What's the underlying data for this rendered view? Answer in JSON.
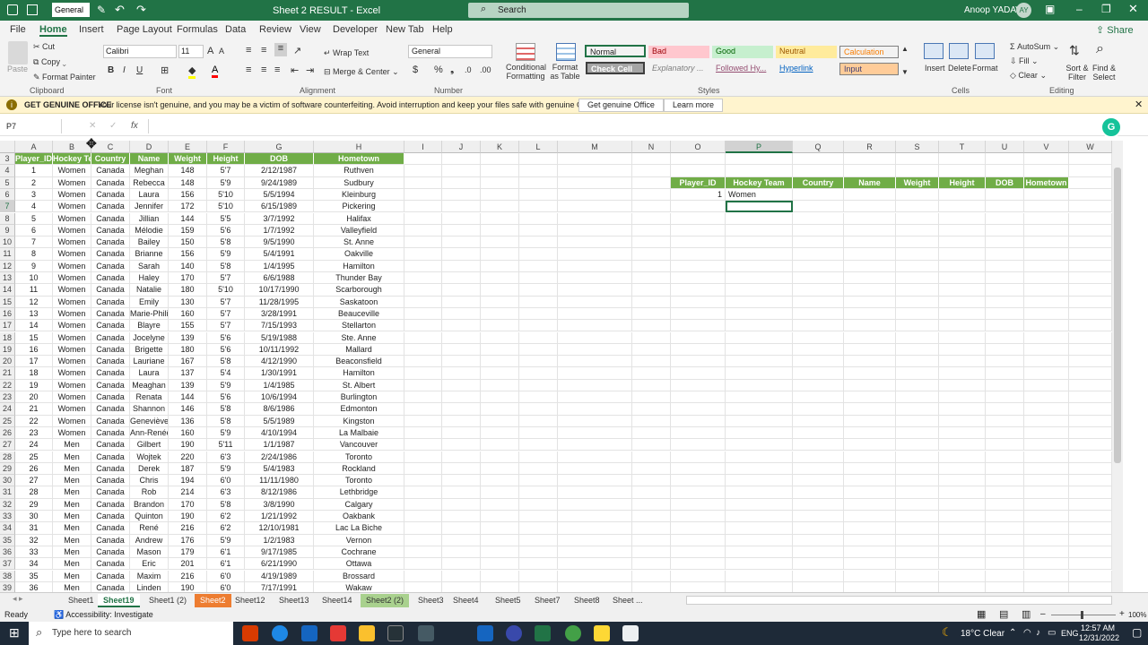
{
  "title_bar": {
    "number_format": "General",
    "title": "Sheet 2 RESULT  -  Excel",
    "search": "Search",
    "user": "Anoop YADAV",
    "initials": "AY"
  },
  "menu": [
    "File",
    "Home",
    "Insert",
    "Page Layout",
    "Formulas",
    "Data",
    "Review",
    "View",
    "Developer",
    "New Tab",
    "Help"
  ],
  "share": "Share",
  "ribbon": {
    "paste": "Paste",
    "cut": "Cut",
    "copy": "Copy",
    "format_painter": "Format Painter",
    "clipboard": "Clipboard",
    "font_name": "Calibri",
    "font_size": "11",
    "font": "Font",
    "wrap_text": "Wrap Text",
    "merge_center": "Merge & Center",
    "alignment": "Alignment",
    "number_format": "General",
    "number": "Number",
    "conditional": "Conditional Formatting",
    "format_as_table": "Format as Table",
    "styles": "Styles",
    "style_cells": [
      {
        "label": "Normal",
        "bg": "#ffffff",
        "color": "#000000"
      },
      {
        "label": "Bad",
        "bg": "#ffc7ce",
        "color": "#9c0006"
      },
      {
        "label": "Good",
        "bg": "#c6efce",
        "color": "#006100"
      },
      {
        "label": "Neutral",
        "bg": "#ffeb9c",
        "color": "#9c5700"
      },
      {
        "label": "Calculation",
        "bg": "#f2f2f2",
        "color": "#fa7d00"
      },
      {
        "label": "Check Cell",
        "bg": "#a5a5a5",
        "color": "#ffffff"
      },
      {
        "label": "Explanatory ...",
        "bg": "#ffffff",
        "color": "#7f7f7f"
      },
      {
        "label": "Followed Hy...",
        "bg": "#ffffff",
        "color": "#954f72"
      },
      {
        "label": "Hyperlink",
        "bg": "#ffffff",
        "color": "#0563c1"
      },
      {
        "label": "Input",
        "bg": "#ffcc99",
        "color": "#3f3f76"
      }
    ],
    "insert": "Insert",
    "delete": "Delete",
    "format": "Format",
    "cells": "Cells",
    "autosum": "AutoSum",
    "fill": "Fill",
    "clear": "Clear",
    "sort_filter": "Sort & Filter",
    "find_select": "Find & Select",
    "editing": "Editing"
  },
  "message": {
    "title": "GET GENUINE OFFICE",
    "text": "Your license isn't genuine, and you may be a victim of software counterfeiting. Avoid interruption and keep your files safe with genuine Office today.",
    "btn1": "Get genuine Office",
    "btn2": "Learn more"
  },
  "namebox": "P7",
  "fx": "fx",
  "columns": [
    "A",
    "B",
    "C",
    "D",
    "E",
    "F",
    "G",
    "H",
    "I",
    "J",
    "K",
    "L",
    "M",
    "N",
    "O",
    "P",
    "Q",
    "R",
    "S",
    "T",
    "U",
    "V",
    "W"
  ],
  "table_headers": [
    "Player_ID",
    "Hockey Team",
    "Country",
    "Name",
    "Weight",
    "Height",
    "DOB",
    "Hometown"
  ],
  "rows": [
    [
      "1",
      "Women",
      "Canada",
      "Meghan",
      "148",
      "5'7",
      "2/12/1987",
      "Ruthven"
    ],
    [
      "2",
      "Women",
      "Canada",
      "Rebecca",
      "148",
      "5'9",
      "9/24/1989",
      "Sudbury"
    ],
    [
      "3",
      "Women",
      "Canada",
      "Laura",
      "156",
      "5'10",
      "5/5/1994",
      "Kleinburg"
    ],
    [
      "4",
      "Women",
      "Canada",
      "Jennifer",
      "172",
      "5'10",
      "6/15/1989",
      "Pickering"
    ],
    [
      "5",
      "Women",
      "Canada",
      "Jillian",
      "144",
      "5'5",
      "3/7/1992",
      "Halifax"
    ],
    [
      "6",
      "Women",
      "Canada",
      "Mélodie",
      "159",
      "5'6",
      "1/7/1992",
      "Valleyfield"
    ],
    [
      "7",
      "Women",
      "Canada",
      "Bailey",
      "150",
      "5'8",
      "9/5/1990",
      "St. Anne"
    ],
    [
      "8",
      "Women",
      "Canada",
      "Brianne",
      "156",
      "5'9",
      "5/4/1991",
      "Oakville"
    ],
    [
      "9",
      "Women",
      "Canada",
      "Sarah",
      "140",
      "5'8",
      "1/4/1995",
      "Hamilton"
    ],
    [
      "10",
      "Women",
      "Canada",
      "Haley",
      "170",
      "5'7",
      "6/6/1988",
      "Thunder Bay"
    ],
    [
      "11",
      "Women",
      "Canada",
      "Natalie",
      "180",
      "5'10",
      "10/17/1990",
      "Scarborough"
    ],
    [
      "12",
      "Women",
      "Canada",
      "Emily",
      "130",
      "5'7",
      "11/28/1995",
      "Saskatoon"
    ],
    [
      "13",
      "Women",
      "Canada",
      "Marie-Philip",
      "160",
      "5'7",
      "3/28/1991",
      "Beauceville"
    ],
    [
      "14",
      "Women",
      "Canada",
      "Blayre",
      "155",
      "5'7",
      "7/15/1993",
      "Stellarton"
    ],
    [
      "15",
      "Women",
      "Canada",
      "Jocelyne",
      "139",
      "5'6",
      "5/19/1988",
      "Ste. Anne"
    ],
    [
      "16",
      "Women",
      "Canada",
      "Brigette",
      "180",
      "5'6",
      "10/11/1992",
      "Mallard"
    ],
    [
      "17",
      "Women",
      "Canada",
      "Lauriane",
      "167",
      "5'8",
      "4/12/1990",
      "Beaconsfield"
    ],
    [
      "18",
      "Women",
      "Canada",
      "Laura",
      "137",
      "5'4",
      "1/30/1991",
      "Hamilton"
    ],
    [
      "19",
      "Women",
      "Canada",
      "Meaghan",
      "139",
      "5'9",
      "1/4/1985",
      "St. Albert"
    ],
    [
      "20",
      "Women",
      "Canada",
      "Renata",
      "144",
      "5'6",
      "10/6/1994",
      "Burlington"
    ],
    [
      "21",
      "Women",
      "Canada",
      "Shannon",
      "146",
      "5'8",
      "8/6/1986",
      "Edmonton"
    ],
    [
      "22",
      "Women",
      "Canada",
      "Geneviève",
      "136",
      "5'8",
      "5/5/1989",
      "Kingston"
    ],
    [
      "23",
      "Women",
      "Canada",
      "Ann-Renée",
      "160",
      "5'9",
      "4/10/1994",
      "La Malbaie"
    ],
    [
      "24",
      "Men",
      "Canada",
      "Gilbert",
      "190",
      "5'11",
      "1/1/1987",
      "Vancouver"
    ],
    [
      "25",
      "Men",
      "Canada",
      "Wojtek",
      "220",
      "6'3",
      "2/24/1986",
      "Toronto"
    ],
    [
      "26",
      "Men",
      "Canada",
      "Derek",
      "187",
      "5'9",
      "5/4/1983",
      "Rockland"
    ],
    [
      "27",
      "Men",
      "Canada",
      "Chris",
      "194",
      "6'0",
      "11/11/1980",
      "Toronto"
    ],
    [
      "28",
      "Men",
      "Canada",
      "Rob",
      "214",
      "6'3",
      "8/12/1986",
      "Lethbridge"
    ],
    [
      "29",
      "Men",
      "Canada",
      "Brandon",
      "170",
      "5'8",
      "3/8/1990",
      "Calgary"
    ],
    [
      "30",
      "Men",
      "Canada",
      "Quinton",
      "190",
      "6'2",
      "1/21/1992",
      "Oakbank"
    ],
    [
      "31",
      "Men",
      "Canada",
      "René",
      "216",
      "6'2",
      "12/10/1981",
      "Lac La Biche"
    ],
    [
      "32",
      "Men",
      "Canada",
      "Andrew",
      "176",
      "5'9",
      "1/2/1983",
      "Vernon"
    ],
    [
      "33",
      "Men",
      "Canada",
      "Mason",
      "179",
      "6'1",
      "9/17/1985",
      "Cochrane"
    ],
    [
      "34",
      "Men",
      "Canada",
      "Eric",
      "201",
      "6'1",
      "6/21/1990",
      "Ottawa"
    ],
    [
      "35",
      "Men",
      "Canada",
      "Maxim",
      "216",
      "6'0",
      "4/19/1989",
      "Brossard"
    ],
    [
      "36",
      "Men",
      "Canada",
      "Linden",
      "190",
      "6'0",
      "7/17/1991",
      "Wakaw"
    ]
  ],
  "row_numbers": [
    "3",
    "4",
    "5",
    "6",
    "7",
    "8",
    "9",
    "10",
    "11",
    "12",
    "13",
    "14",
    "15",
    "16",
    "17",
    "18",
    "19",
    "20",
    "21",
    "22",
    "23",
    "24",
    "25",
    "26",
    "27",
    "28",
    "29",
    "30",
    "31",
    "32",
    "33",
    "34",
    "35",
    "36",
    "37",
    "38",
    "39"
  ],
  "result_headers": [
    "Player_ID",
    "Hockey Team",
    "Country",
    "Name",
    "Weight",
    "Height",
    "DOB",
    "Hometown"
  ],
  "result_row": [
    "1",
    "Women"
  ],
  "sheets": [
    {
      "name": "Sheet1"
    },
    {
      "name": "Sheet19",
      "active": true
    },
    {
      "name": "Sheet1 (2)"
    },
    {
      "name": "Sheet2",
      "color": "#ed7d31"
    },
    {
      "name": "Sheet12"
    },
    {
      "name": "Sheet13"
    },
    {
      "name": "Sheet14"
    },
    {
      "name": "Sheet2 (2)",
      "color": "#a9d18e"
    },
    {
      "name": "Sheet3"
    },
    {
      "name": "Sheet4"
    },
    {
      "name": "Sheet5"
    },
    {
      "name": "Sheet7"
    },
    {
      "name": "Sheet8"
    },
    {
      "name": "Sheet ..."
    }
  ],
  "status": {
    "ready": "Ready",
    "accessibility": "Accessibility: Investigate",
    "zoom": "100%"
  },
  "taskbar": {
    "search": "Type here to search",
    "weather": "18°C  Clear",
    "lang": "ENG",
    "time": "12:57 AM",
    "date": "12/31/2022"
  },
  "colors": {
    "excel_green": "#217346",
    "header_green": "#70ad47"
  }
}
